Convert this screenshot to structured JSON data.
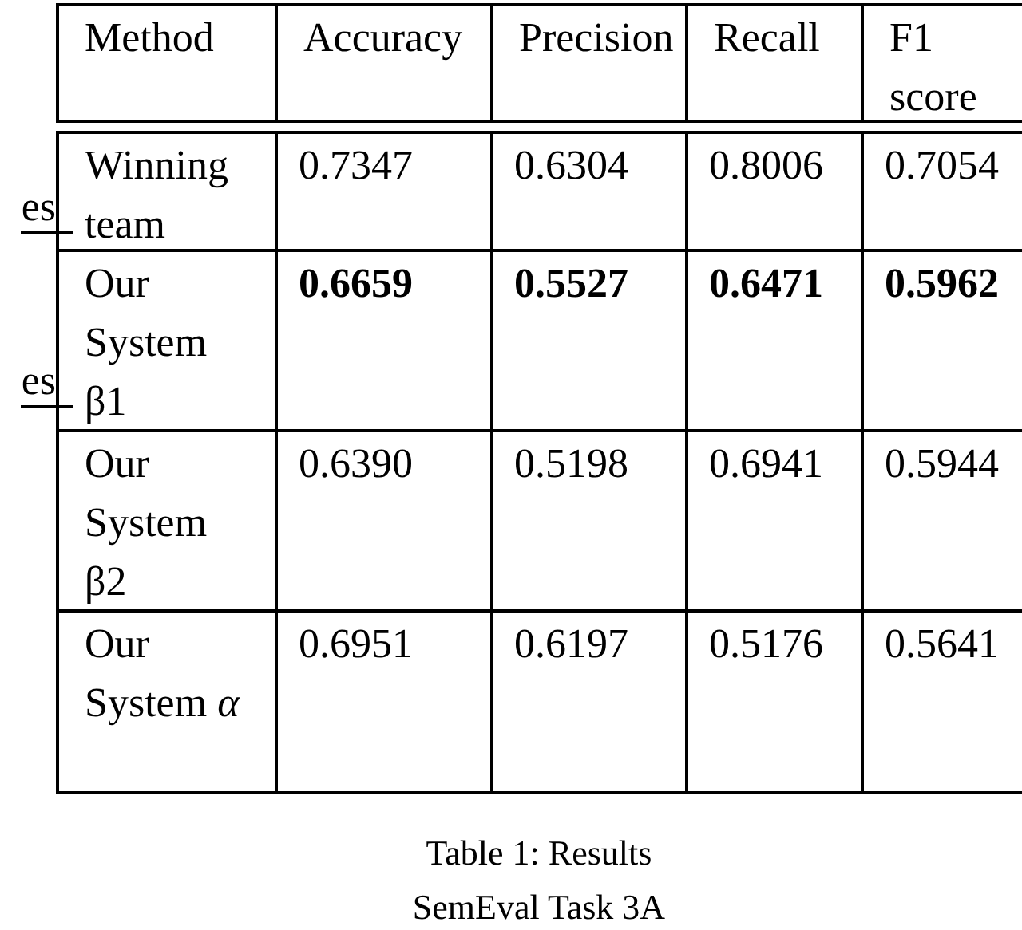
{
  "margin_fragments": [
    "es",
    "es"
  ],
  "table": {
    "columns": [
      "Method",
      "Accuracy",
      "Precision",
      "Recall",
      "F1 score"
    ],
    "rows": [
      {
        "bold": false,
        "cells": [
          "Winning team",
          "0.7347",
          "0.6304",
          "0.8006",
          "0.7054"
        ]
      },
      {
        "bold": true,
        "cells": [
          "Our System β1",
          "0.6659",
          "0.5527",
          "0.6471",
          "0.5962"
        ]
      },
      {
        "bold": false,
        "cells": [
          "Our System β2",
          "0.6390",
          "0.5198",
          "0.6941",
          "0.5944"
        ]
      },
      {
        "bold": false,
        "cells": [
          "Our System *α*",
          "0.6951",
          "0.6197",
          "0.5176",
          "0.5641"
        ]
      }
    ]
  },
  "caption": [
    "Table 1: Results",
    "SemEval Task 3A"
  ]
}
